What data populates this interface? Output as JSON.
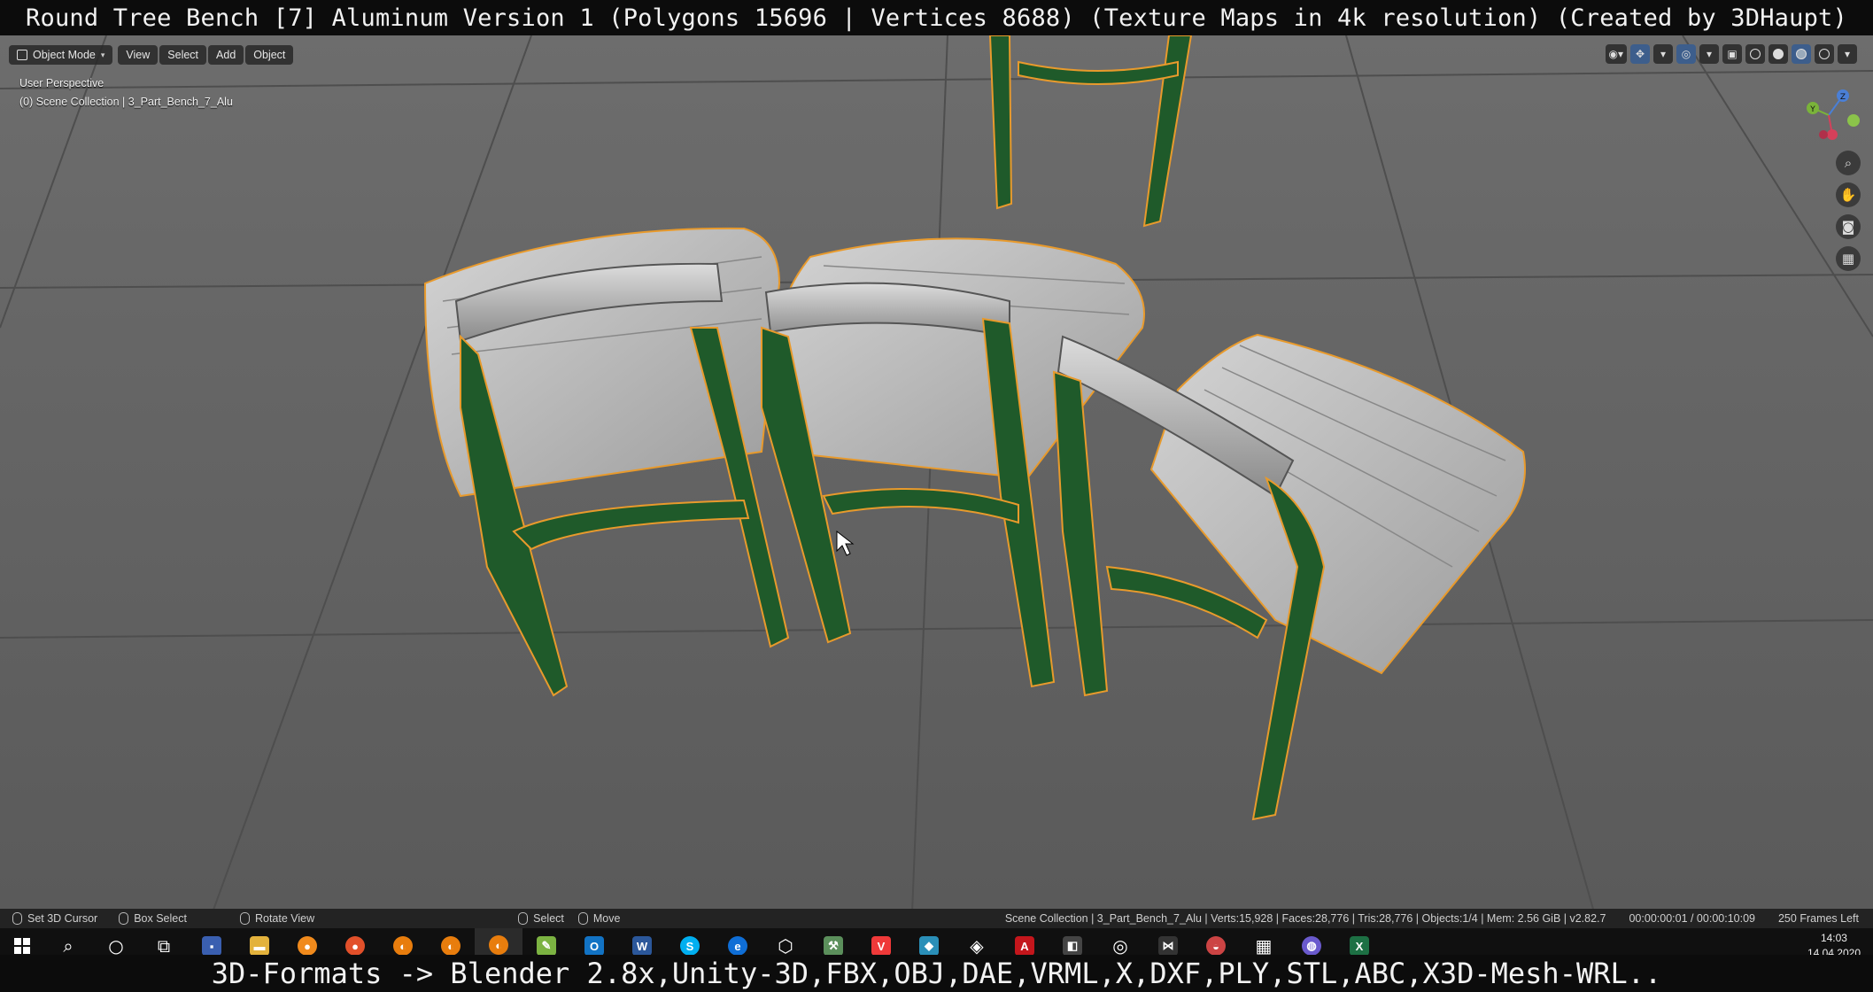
{
  "title_overlay": "Round Tree Bench [7] Aluminum Version 1 (Polygons 15696 | Vertices 8688) (Texture Maps in 4k resolution) (Created by 3DHaupt)",
  "viewport": {
    "header": {
      "mode": "Object Mode",
      "menus": [
        "View",
        "Select",
        "Add",
        "Object"
      ]
    },
    "perspective_label": "User Perspective",
    "collection_label": "(0) Scene Collection | 3_Part_Bench_7_Alu",
    "gizmo": {
      "x": "X",
      "y": "Y",
      "z": "Z"
    },
    "nav_icons": [
      "zoom-icon",
      "pan-hand-icon",
      "camera-icon",
      "grid-icon"
    ],
    "colors": {
      "bench_frame": "#1f5a2a",
      "selection_outline": "#e89a2c",
      "floor": "#666666",
      "slats": "#b9b9b9"
    }
  },
  "status_bar": {
    "left": [
      {
        "icon": "mouse-left-icon",
        "label": "Set 3D Cursor"
      },
      {
        "icon": "mouse-left-icon",
        "label": "Box Select"
      },
      {
        "icon": "mouse-middle-icon",
        "label": "Rotate View"
      },
      {
        "icon": "mouse-left-icon",
        "label": "Select"
      },
      {
        "icon": "mouse-right-icon",
        "label": "Move"
      }
    ],
    "scene_stats": "Scene Collection | 3_Part_Bench_7_Alu | Verts:15,928 | Faces:28,776 | Tris:28,776 | Objects:1/4 | Mem: 2.56 GiB | v2.82.7",
    "timecode": "00:00:00:01 / 00:00:10:09",
    "frames_left": "250 Frames Left"
  },
  "taskbar": {
    "icons": [
      "windows-start-icon",
      "search-icon",
      "cortana-icon",
      "task-view-icon",
      "save-icon",
      "file-explorer-icon",
      "firefox-dev-icon",
      "firefox-icon",
      "blender-icon",
      "blender-icon",
      "blender-icon",
      "notepad-icon",
      "outlook-icon",
      "word-icon",
      "skype-icon",
      "edge-icon",
      "cube-icon",
      "tool-icon",
      "vivaldi-icon",
      "app-icon",
      "acrobat-icon",
      "unity-icon",
      "app-icon",
      "vs-icon",
      "app-icon",
      "calculator-icon",
      "maps-icon",
      "excel-icon"
    ],
    "time": "14:03",
    "date": "14.04.2020"
  },
  "bottom_overlay": "3D-Formats -> Blender 2.8x,Unity-3D,FBX,OBJ,DAE,VRML,X,DXF,PLY,STL,ABC,X3D-Mesh-WRL.."
}
